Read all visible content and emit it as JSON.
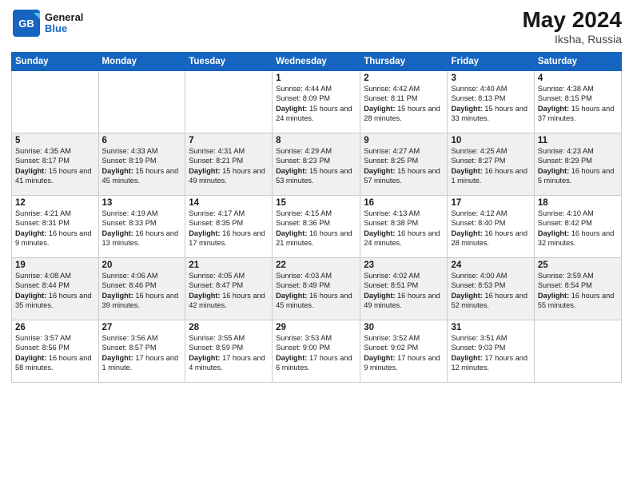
{
  "logo": {
    "general": "General",
    "blue": "Blue"
  },
  "title": {
    "month": "May 2024",
    "location": "Iksha, Russia"
  },
  "headers": [
    "Sunday",
    "Monday",
    "Tuesday",
    "Wednesday",
    "Thursday",
    "Friday",
    "Saturday"
  ],
  "weeks": [
    [
      {
        "day": "",
        "sunrise": "",
        "sunset": "",
        "daylight": ""
      },
      {
        "day": "",
        "sunrise": "",
        "sunset": "",
        "daylight": ""
      },
      {
        "day": "",
        "sunrise": "",
        "sunset": "",
        "daylight": ""
      },
      {
        "day": "1",
        "sunrise": "Sunrise: 4:44 AM",
        "sunset": "Sunset: 8:09 PM",
        "daylight": "Daylight: 15 hours and 24 minutes."
      },
      {
        "day": "2",
        "sunrise": "Sunrise: 4:42 AM",
        "sunset": "Sunset: 8:11 PM",
        "daylight": "Daylight: 15 hours and 28 minutes."
      },
      {
        "day": "3",
        "sunrise": "Sunrise: 4:40 AM",
        "sunset": "Sunset: 8:13 PM",
        "daylight": "Daylight: 15 hours and 33 minutes."
      },
      {
        "day": "4",
        "sunrise": "Sunrise: 4:38 AM",
        "sunset": "Sunset: 8:15 PM",
        "daylight": "Daylight: 15 hours and 37 minutes."
      }
    ],
    [
      {
        "day": "5",
        "sunrise": "Sunrise: 4:35 AM",
        "sunset": "Sunset: 8:17 PM",
        "daylight": "Daylight: 15 hours and 41 minutes."
      },
      {
        "day": "6",
        "sunrise": "Sunrise: 4:33 AM",
        "sunset": "Sunset: 8:19 PM",
        "daylight": "Daylight: 15 hours and 45 minutes."
      },
      {
        "day": "7",
        "sunrise": "Sunrise: 4:31 AM",
        "sunset": "Sunset: 8:21 PM",
        "daylight": "Daylight: 15 hours and 49 minutes."
      },
      {
        "day": "8",
        "sunrise": "Sunrise: 4:29 AM",
        "sunset": "Sunset: 8:23 PM",
        "daylight": "Daylight: 15 hours and 53 minutes."
      },
      {
        "day": "9",
        "sunrise": "Sunrise: 4:27 AM",
        "sunset": "Sunset: 8:25 PM",
        "daylight": "Daylight: 15 hours and 57 minutes."
      },
      {
        "day": "10",
        "sunrise": "Sunrise: 4:25 AM",
        "sunset": "Sunset: 8:27 PM",
        "daylight": "Daylight: 16 hours and 1 minute."
      },
      {
        "day": "11",
        "sunrise": "Sunrise: 4:23 AM",
        "sunset": "Sunset: 8:29 PM",
        "daylight": "Daylight: 16 hours and 5 minutes."
      }
    ],
    [
      {
        "day": "12",
        "sunrise": "Sunrise: 4:21 AM",
        "sunset": "Sunset: 8:31 PM",
        "daylight": "Daylight: 16 hours and 9 minutes."
      },
      {
        "day": "13",
        "sunrise": "Sunrise: 4:19 AM",
        "sunset": "Sunset: 8:33 PM",
        "daylight": "Daylight: 16 hours and 13 minutes."
      },
      {
        "day": "14",
        "sunrise": "Sunrise: 4:17 AM",
        "sunset": "Sunset: 8:35 PM",
        "daylight": "Daylight: 16 hours and 17 minutes."
      },
      {
        "day": "15",
        "sunrise": "Sunrise: 4:15 AM",
        "sunset": "Sunset: 8:36 PM",
        "daylight": "Daylight: 16 hours and 21 minutes."
      },
      {
        "day": "16",
        "sunrise": "Sunrise: 4:13 AM",
        "sunset": "Sunset: 8:38 PM",
        "daylight": "Daylight: 16 hours and 24 minutes."
      },
      {
        "day": "17",
        "sunrise": "Sunrise: 4:12 AM",
        "sunset": "Sunset: 8:40 PM",
        "daylight": "Daylight: 16 hours and 28 minutes."
      },
      {
        "day": "18",
        "sunrise": "Sunrise: 4:10 AM",
        "sunset": "Sunset: 8:42 PM",
        "daylight": "Daylight: 16 hours and 32 minutes."
      }
    ],
    [
      {
        "day": "19",
        "sunrise": "Sunrise: 4:08 AM",
        "sunset": "Sunset: 8:44 PM",
        "daylight": "Daylight: 16 hours and 35 minutes."
      },
      {
        "day": "20",
        "sunrise": "Sunrise: 4:06 AM",
        "sunset": "Sunset: 8:46 PM",
        "daylight": "Daylight: 16 hours and 39 minutes."
      },
      {
        "day": "21",
        "sunrise": "Sunrise: 4:05 AM",
        "sunset": "Sunset: 8:47 PM",
        "daylight": "Daylight: 16 hours and 42 minutes."
      },
      {
        "day": "22",
        "sunrise": "Sunrise: 4:03 AM",
        "sunset": "Sunset: 8:49 PM",
        "daylight": "Daylight: 16 hours and 45 minutes."
      },
      {
        "day": "23",
        "sunrise": "Sunrise: 4:02 AM",
        "sunset": "Sunset: 8:51 PM",
        "daylight": "Daylight: 16 hours and 49 minutes."
      },
      {
        "day": "24",
        "sunrise": "Sunrise: 4:00 AM",
        "sunset": "Sunset: 8:53 PM",
        "daylight": "Daylight: 16 hours and 52 minutes."
      },
      {
        "day": "25",
        "sunrise": "Sunrise: 3:59 AM",
        "sunset": "Sunset: 8:54 PM",
        "daylight": "Daylight: 16 hours and 55 minutes."
      }
    ],
    [
      {
        "day": "26",
        "sunrise": "Sunrise: 3:57 AM",
        "sunset": "Sunset: 8:56 PM",
        "daylight": "Daylight: 16 hours and 58 minutes."
      },
      {
        "day": "27",
        "sunrise": "Sunrise: 3:56 AM",
        "sunset": "Sunset: 8:57 PM",
        "daylight": "Daylight: 17 hours and 1 minute."
      },
      {
        "day": "28",
        "sunrise": "Sunrise: 3:55 AM",
        "sunset": "Sunset: 8:59 PM",
        "daylight": "Daylight: 17 hours and 4 minutes."
      },
      {
        "day": "29",
        "sunrise": "Sunrise: 3:53 AM",
        "sunset": "Sunset: 9:00 PM",
        "daylight": "Daylight: 17 hours and 6 minutes."
      },
      {
        "day": "30",
        "sunrise": "Sunrise: 3:52 AM",
        "sunset": "Sunset: 9:02 PM",
        "daylight": "Daylight: 17 hours and 9 minutes."
      },
      {
        "day": "31",
        "sunrise": "Sunrise: 3:51 AM",
        "sunset": "Sunset: 9:03 PM",
        "daylight": "Daylight: 17 hours and 12 minutes."
      },
      {
        "day": "",
        "sunrise": "",
        "sunset": "",
        "daylight": ""
      }
    ]
  ]
}
